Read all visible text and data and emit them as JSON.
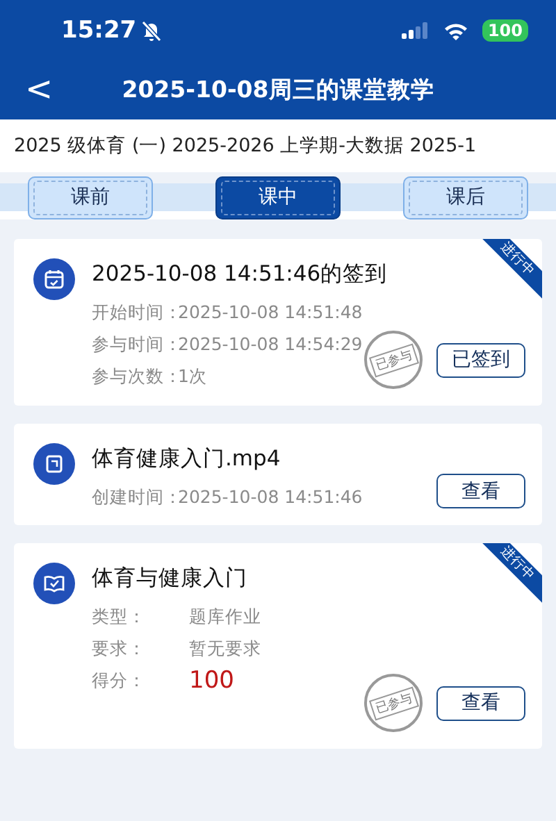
{
  "status_bar": {
    "time": "15:27",
    "battery": "100"
  },
  "nav": {
    "back": "<",
    "title": "2025-10-08周三的课堂教学"
  },
  "course": "2025 级体育 (一) 2025-2026 上学期-大数据 2025-1",
  "tabs": [
    {
      "label": "课前",
      "selected": false
    },
    {
      "label": "课中",
      "selected": true
    },
    {
      "label": "课后",
      "selected": false
    }
  ],
  "cards": [
    {
      "kind": "signin",
      "title": "2025-10-08 14:51:46的签到",
      "ribbon": "进行中",
      "stamp": "已参与",
      "button": "已签到",
      "fields": [
        {
          "kind": "text",
          "label": "开始时间：",
          "value": "2025-10-08 14:51:48"
        },
        {
          "kind": "text",
          "label": "参与时间：",
          "value": "2025-10-08 14:54:29"
        },
        {
          "kind": "text",
          "label": "参与次数：",
          "value": "1次"
        }
      ]
    },
    {
      "kind": "video",
      "title": "体育健康入门.mp4",
      "button": "查看",
      "fields": [
        {
          "kind": "text",
          "label": "创建时间：",
          "value": "2025-10-08 14:51:46"
        }
      ]
    },
    {
      "kind": "homework",
      "title": "体育与健康入门",
      "ribbon": "进行中",
      "stamp": "已参与",
      "button": "查看",
      "fields": [
        {
          "kind": "text",
          "label": "类型：",
          "value": "题库作业"
        },
        {
          "kind": "text",
          "label": "要求：",
          "value": "暂无要求"
        },
        {
          "kind": "score",
          "label": "得分：",
          "value": "100"
        }
      ]
    }
  ]
}
